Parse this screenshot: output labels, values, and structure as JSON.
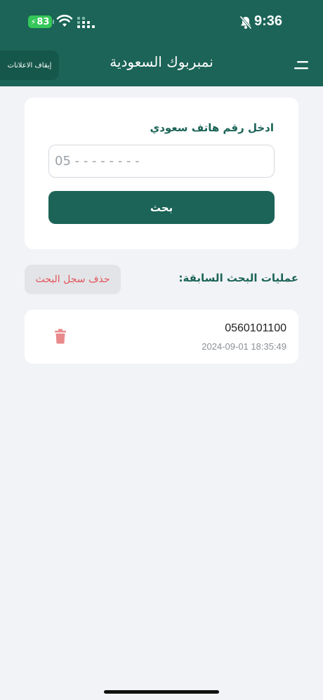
{
  "status_bar": {
    "battery_level": "83",
    "time": "9:36",
    "icons": [
      "charging-bolt-icon",
      "wifi-icon",
      "cellular-signal-icon",
      "bell-muted-icon"
    ]
  },
  "header": {
    "title": "نمبربوك السعودية",
    "stop_ads_label": "إيقاف الاعلانات",
    "menu_icon": "menu-icon"
  },
  "search": {
    "label": "ادخل رقم هاتف سعودي",
    "placeholder": "05 - - - - - - - -",
    "value": "",
    "button_label": "بحث"
  },
  "history": {
    "title": "عمليات البحث السابقة:",
    "clear_label": "حذف سجل البحث",
    "items": [
      {
        "number": "0560101100",
        "date": "2024-09-01 18:35:49",
        "delete_icon": "trash-icon"
      }
    ]
  },
  "colors": {
    "primary": "#1B6457",
    "background": "#F2F3F7",
    "danger": "#E0555A",
    "battery": "#34C759"
  }
}
